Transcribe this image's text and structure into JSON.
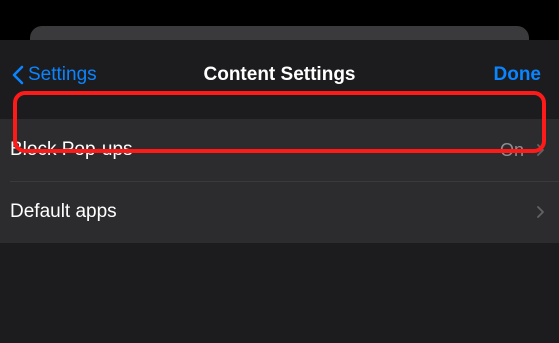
{
  "nav": {
    "back_label": "Settings",
    "title": "Content Settings",
    "done_label": "Done"
  },
  "rows": [
    {
      "label": "Block Pop-ups",
      "value": "On"
    },
    {
      "label": "Default apps",
      "value": ""
    }
  ],
  "colors": {
    "accent": "#0a84ff",
    "highlight": "#ff1a1a",
    "background": "#1c1c1e",
    "row_background": "#2c2c2e"
  },
  "icons": {
    "back": "chevron-left-icon",
    "disclosure": "chevron-right-icon"
  }
}
